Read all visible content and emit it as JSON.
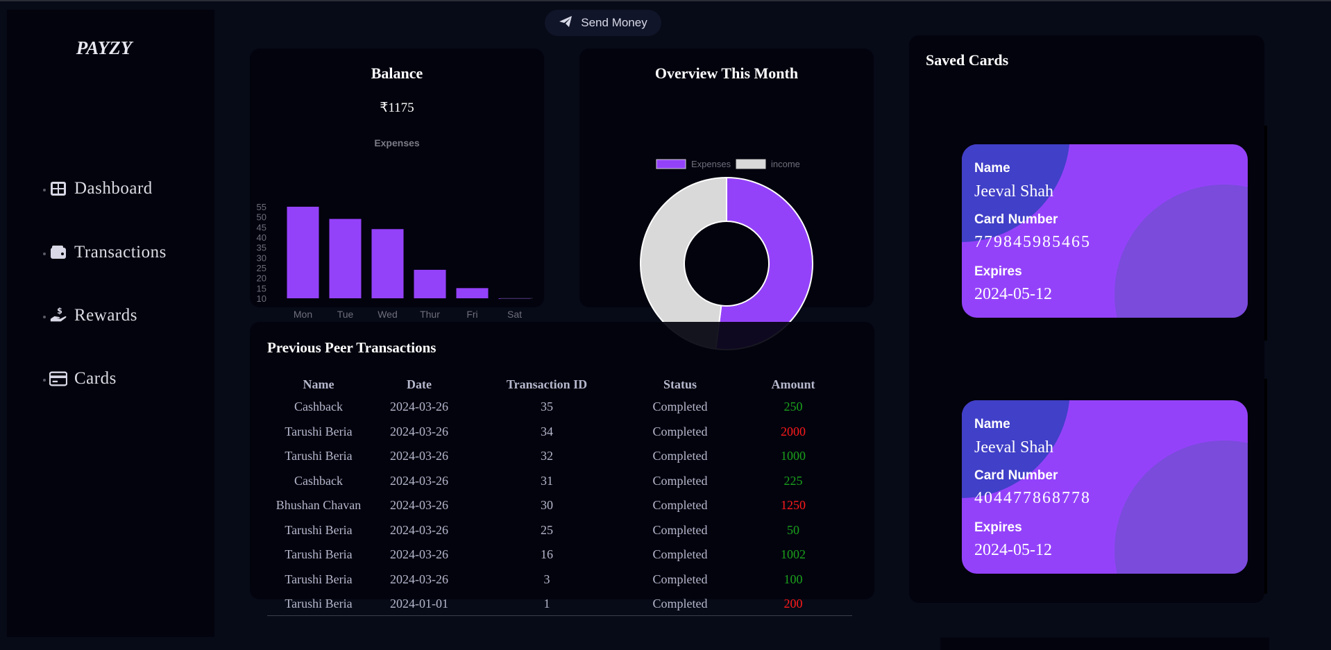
{
  "app": {
    "logo": "PAYZY"
  },
  "sidebar": {
    "items": [
      {
        "label": "Dashboard",
        "icon": "table-icon"
      },
      {
        "label": "Transactions",
        "icon": "wallet-icon"
      },
      {
        "label": "Rewards",
        "icon": "hand-coin-icon"
      },
      {
        "label": "Cards",
        "icon": "credit-card-icon"
      }
    ]
  },
  "header": {
    "send_money_label": "Send Money",
    "send_icon": "paper-plane-icon"
  },
  "balance": {
    "title": "Balance",
    "amount": "₹1175",
    "chart_data": {
      "type": "bar",
      "title": "Expenses",
      "categories": [
        "Mon",
        "Tue",
        "Wed",
        "Thur",
        "Fri",
        "Sat"
      ],
      "values": [
        55,
        49,
        44,
        24,
        15,
        10
      ],
      "yticks": [
        10,
        15,
        20,
        25,
        30,
        35,
        40,
        45,
        50,
        55
      ],
      "ylim": [
        10,
        55
      ],
      "grid": false,
      "color": "#9442fa"
    }
  },
  "overview": {
    "title": "Overview This Month",
    "chart_data": {
      "type": "pie",
      "variant": "doughnut",
      "labels": [
        "Expenses",
        "income"
      ],
      "values": [
        52,
        48
      ],
      "colors": [
        "#9442fa",
        "#d9d9d9"
      ],
      "legend": "top"
    }
  },
  "transactions": {
    "title": "Previous Peer Transactions",
    "columns": [
      "Name",
      "Date",
      "Transaction ID",
      "Status",
      "Amount"
    ],
    "rows": [
      {
        "name": "Cashback",
        "date": "2024-03-26",
        "id": "35",
        "status": "Completed",
        "amount": "250",
        "type": "credit"
      },
      {
        "name": "Tarushi Beria",
        "date": "2024-03-26",
        "id": "34",
        "status": "Completed",
        "amount": "2000",
        "type": "debit"
      },
      {
        "name": "Tarushi Beria",
        "date": "2024-03-26",
        "id": "32",
        "status": "Completed",
        "amount": "1000",
        "type": "credit"
      },
      {
        "name": "Cashback",
        "date": "2024-03-26",
        "id": "31",
        "status": "Completed",
        "amount": "225",
        "type": "credit"
      },
      {
        "name": "Bhushan Chavan",
        "date": "2024-03-26",
        "id": "30",
        "status": "Completed",
        "amount": "1250",
        "type": "debit"
      },
      {
        "name": "Tarushi Beria",
        "date": "2024-03-26",
        "id": "25",
        "status": "Completed",
        "amount": "50",
        "type": "credit"
      },
      {
        "name": "Tarushi Beria",
        "date": "2024-03-26",
        "id": "16",
        "status": "Completed",
        "amount": "1002",
        "type": "credit"
      },
      {
        "name": "Tarushi Beria",
        "date": "2024-03-26",
        "id": "3",
        "status": "Completed",
        "amount": "100",
        "type": "credit"
      },
      {
        "name": "Tarushi Beria",
        "date": "2024-01-01",
        "id": "1",
        "status": "Completed",
        "amount": "200",
        "type": "debit"
      }
    ],
    "colors": {
      "credit": "#1aa11a",
      "debit": "#ff1a1a"
    }
  },
  "saved_cards": {
    "title": "Saved Cards",
    "labels": {
      "name": "Name",
      "number": "Card Number",
      "expires": "Expires"
    },
    "cards": [
      {
        "name": "Jeeval Shah",
        "number": "779845985465",
        "expires": "2024-05-12"
      },
      {
        "name": "Jeeval Shah",
        "number": "404477868778",
        "expires": "2024-05-12"
      }
    ]
  }
}
